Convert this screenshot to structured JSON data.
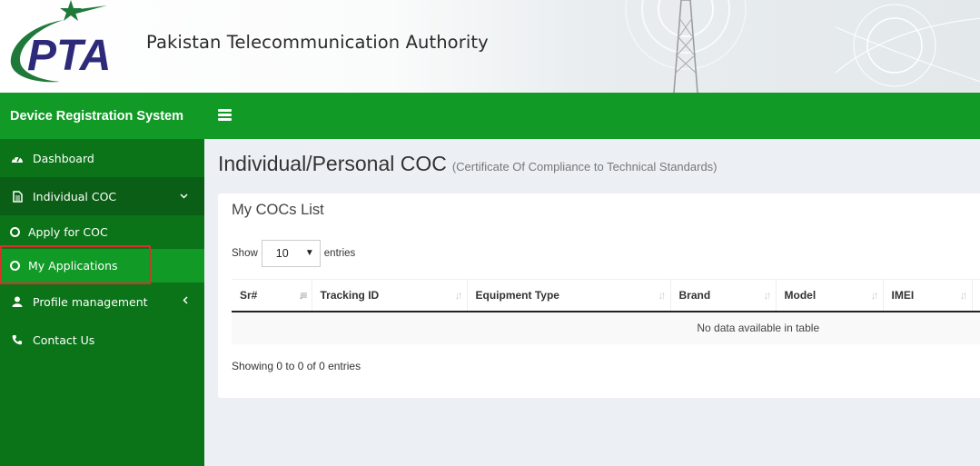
{
  "header": {
    "logo_text": "PTA",
    "org_name": "Pakistan Telecommunication Authority",
    "colors": {
      "logo_blue": "#2e2a7a",
      "logo_green": "#1f7a3a"
    }
  },
  "navbar": {
    "brand": "Device Registration System",
    "toggle_icon": "hamburger-icon",
    "color": "#119a26"
  },
  "sidebar": {
    "items": [
      {
        "label": "Dashboard",
        "icon": "dashboard-icon"
      },
      {
        "label": "Individual COC",
        "icon": "file-icon",
        "expanded": true,
        "chevron": "chevron-down-icon"
      },
      {
        "label": "Profile management",
        "icon": "user-icon",
        "chevron": "chevron-left-icon"
      },
      {
        "label": "Contact Us",
        "icon": "phone-icon"
      }
    ],
    "subitems": [
      {
        "label": "Apply for COC",
        "icon": "circle-icon"
      },
      {
        "label": "My Applications",
        "icon": "circle-icon",
        "active": true
      }
    ],
    "highlight_color": "#d9302a"
  },
  "main": {
    "title": "Individual/Personal COC",
    "subtitle": "(Certificate Of Compliance to Technical Standards)",
    "box": {
      "title": "My COCs List",
      "length_prefix": "Show",
      "length_value": "10",
      "length_suffix": "entries",
      "columns": [
        "Sr#",
        "Tracking ID",
        "Equipment Type",
        "Brand",
        "Model",
        "IMEI"
      ],
      "empty_message": "No data available in table",
      "info": "Showing 0 to 0 of 0 entries"
    }
  }
}
